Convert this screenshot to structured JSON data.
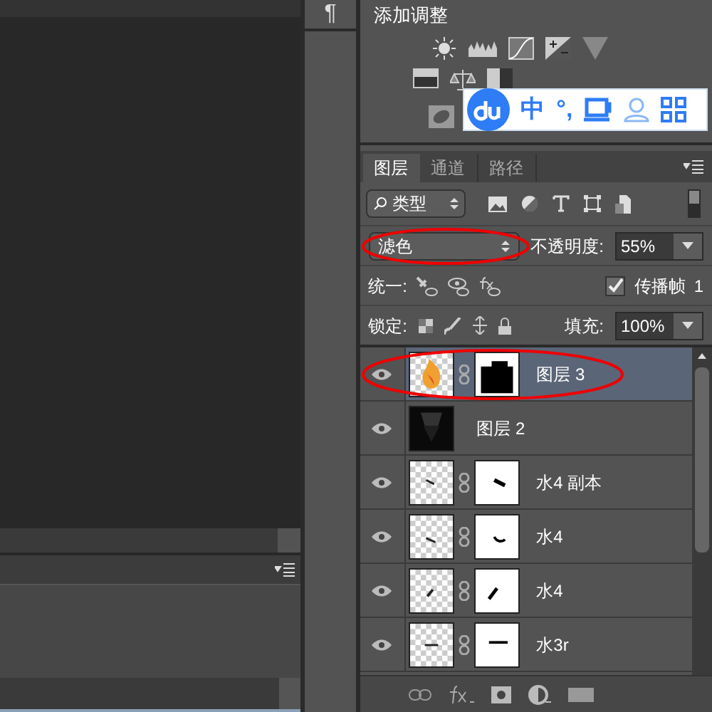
{
  "side_dock": {
    "glyph": "¶"
  },
  "adjustments": {
    "title": "添加调整"
  },
  "ime_bar": {
    "mode": "中",
    "punct": "°,"
  },
  "layers_panel": {
    "tabs": [
      {
        "label": "图层",
        "selected": true
      },
      {
        "label": "通道",
        "selected": false
      },
      {
        "label": "路径",
        "selected": false
      }
    ],
    "filter": {
      "value": "类型",
      "on": false
    },
    "blend_mode": {
      "value": "滤色",
      "circled": true
    },
    "opacity": {
      "label": "不透明度:",
      "value": "55%"
    },
    "unify": {
      "label": "统一:"
    },
    "propagate": {
      "label": "传播帧",
      "checked": true,
      "value": "1"
    },
    "lock": {
      "label": "锁定:"
    },
    "fill": {
      "label": "填充:",
      "value": "100%"
    },
    "layers": [
      {
        "name": "图层 3",
        "kind": "masked",
        "selected": true,
        "circled": true,
        "visible": true
      },
      {
        "name": "图层 2",
        "kind": "plain",
        "selected": false,
        "circled": false,
        "visible": true
      },
      {
        "name": "水4 副本",
        "kind": "masked",
        "selected": false,
        "circled": false,
        "visible": true
      },
      {
        "name": "水4",
        "kind": "masked",
        "selected": false,
        "circled": false,
        "visible": true
      },
      {
        "name": "水4",
        "kind": "masked",
        "selected": false,
        "circled": false,
        "visible": true
      },
      {
        "name": "水3r",
        "kind": "masked",
        "selected": false,
        "circled": false,
        "visible": true
      }
    ]
  }
}
